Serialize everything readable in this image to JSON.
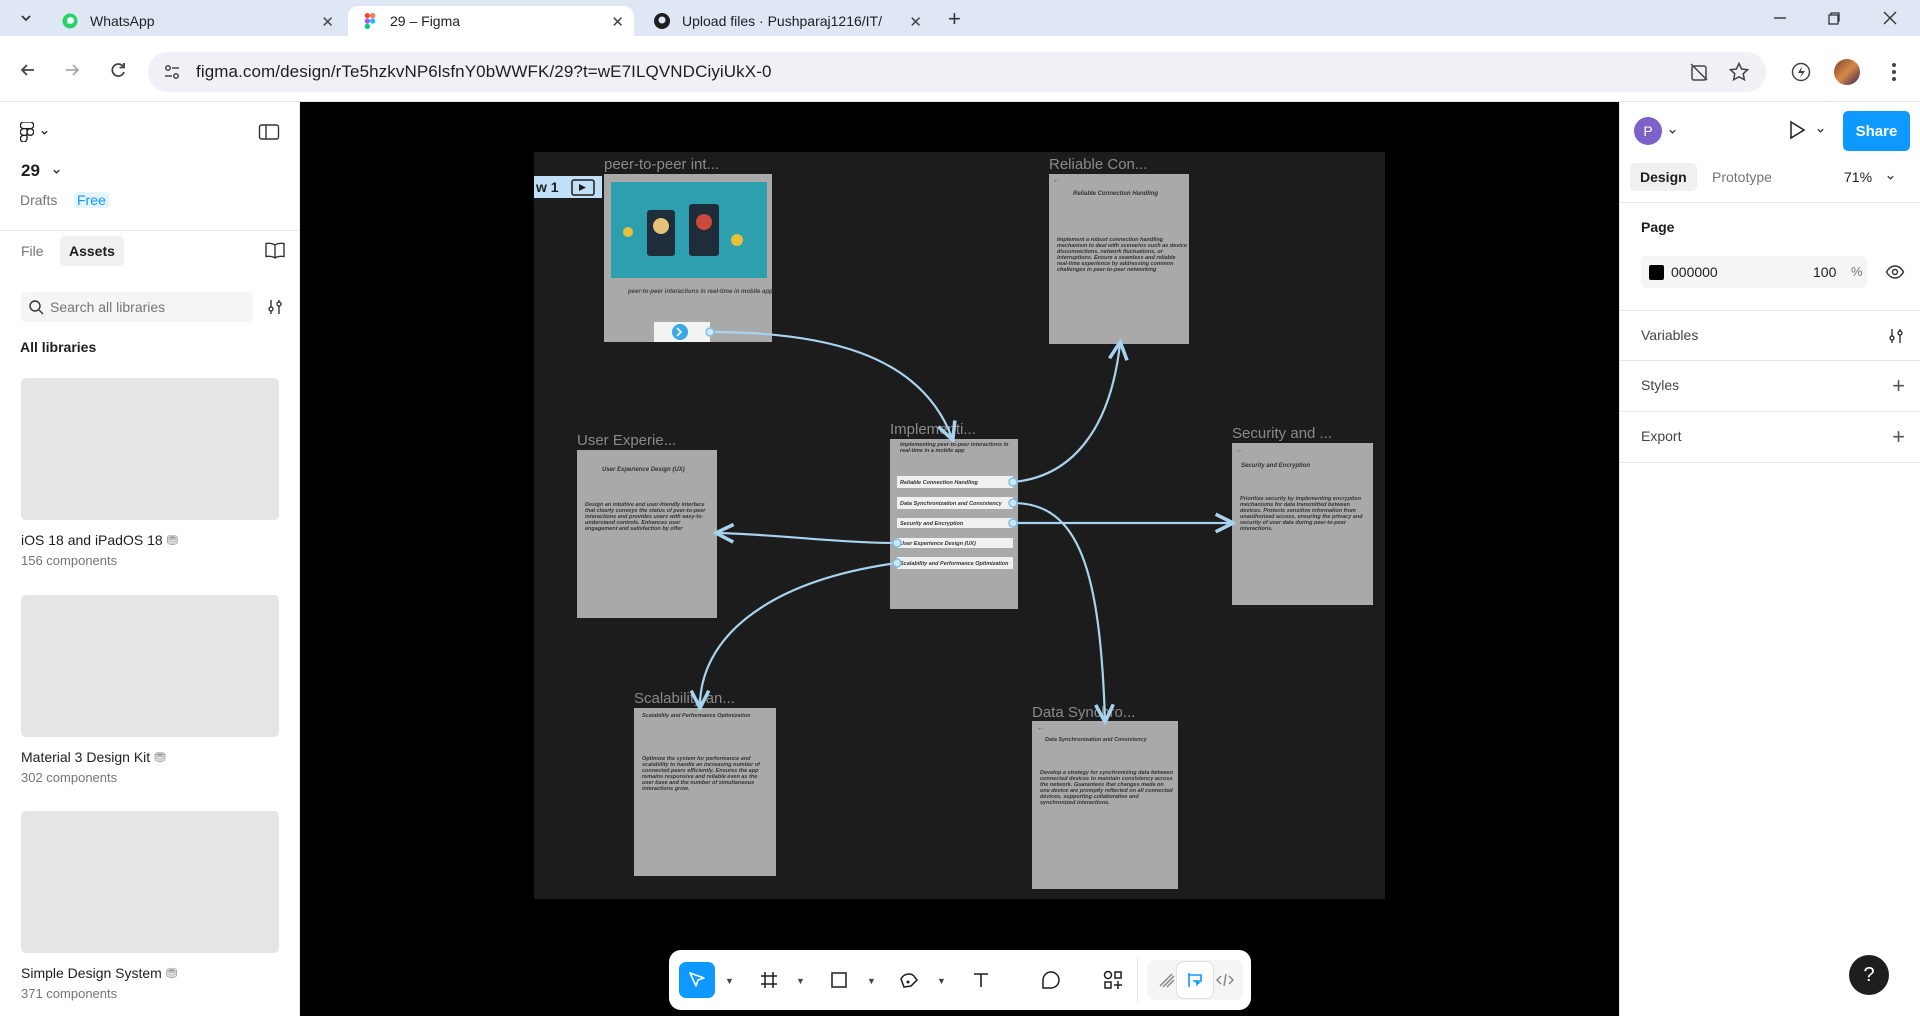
{
  "browser": {
    "tabs": [
      {
        "title": "WhatsApp",
        "icon": "whatsapp-icon"
      },
      {
        "title": "29 – Figma",
        "icon": "figma-icon",
        "active": true
      },
      {
        "title": "Upload files · Pushparaj1216/IT/",
        "icon": "github-icon"
      }
    ],
    "url": "figma.com/design/rTe5hzkvNP6lsfnY0bWWFK/29?t=wE7ILQVNDCiyiUkX-0"
  },
  "left_panel": {
    "file_name": "29",
    "drafts_label": "Drafts",
    "plan_badge": "Free",
    "tabs": [
      "File",
      "Assets"
    ],
    "search_placeholder": "Search all libraries",
    "all_libraries_label": "All libraries",
    "libraries": [
      {
        "name": "iOS 18 and iPadOS 18",
        "count": "156 components"
      },
      {
        "name": "Material 3 Design Kit",
        "count": "302 components"
      },
      {
        "name": "Simple Design System",
        "count": "371 components"
      }
    ]
  },
  "right_panel": {
    "avatar_letter": "P",
    "share_label": "Share",
    "tabs": [
      "Design",
      "Prototype"
    ],
    "zoom": "71%",
    "page_heading": "Page",
    "page_color_hex": "000000",
    "page_opacity": "100",
    "percent_sign": "%",
    "sections": [
      "Variables",
      "Styles",
      "Export"
    ]
  },
  "canvas": {
    "flow_badge": "w 1",
    "frames": [
      {
        "id": "p2p",
        "title": "peer-to-peer int...",
        "body": "peer-to-peer interactions in real-time in mobile app"
      },
      {
        "id": "reliable",
        "title": "Reliable Con...",
        "heading": "Reliable Connection Handling",
        "body": "Implement a robust connection handling mechanism to deal with scenarios such as device disconnections, network fluctuations, or interruptions. Ensure a seamless and reliable real-time experience by addressing common challenges in peer-to-peer networking"
      },
      {
        "id": "ux",
        "title": "User Experie...",
        "heading": "User Experience Design (UX)",
        "body": "Design an intuitive and user-friendly interface that clearly conveys the status of peer-to-peer interactions and provides users with easy-to-understand controls. Enhances user engagement and satisfaction by offer"
      },
      {
        "id": "impl",
        "title": "Implementi...",
        "heading": "Implementing peer-to-peer interactions in real-time in a mobile app",
        "buttons": [
          "Reliable Connection Handling",
          "Data Synchronization and Consistency",
          "Security and Encryption",
          "User Experience Design (UX)",
          "Scalability and Performance Optimization"
        ]
      },
      {
        "id": "security",
        "title": "Security and ...",
        "heading": "Security and Encryption",
        "body": "Prioritize security by implementing encryption mechanisms for data transmitted between devices. Protects sensitive information from unauthorized access, ensuring the privacy and security of user data during peer-to-peer interactions."
      },
      {
        "id": "scal",
        "title": "Scalability an...",
        "heading": "Scalability and Performance Optimization",
        "body": "Optimize the system for performance and scalability to handle an increasing number of connected peers efficiently. Ensures the app remains responsive and reliable even as the user base and the number of simultaneous interactions grow."
      },
      {
        "id": "data",
        "title": "Data Synchro...",
        "heading": "Data Synchronization and Consistency",
        "body": "Develop a strategy for synchronizing data between connected devices to maintain consistency across the network. Guarantees that changes made on one device are promptly reflected on all connected devices, supporting collaborative and synchronized interactions."
      }
    ]
  },
  "toolbar": {
    "tools": [
      "move-tool",
      "frame-tool",
      "shape-tool",
      "pen-tool",
      "text-tool",
      "comment-tool",
      "actions-tool",
      "draw-mode",
      "design-mode",
      "dev-mode"
    ]
  },
  "help_label": "?",
  "colors": {
    "accent": "#0d99ff",
    "canvas": "#000000",
    "frame": "#a9a9a9",
    "connector": "#a8d3f0"
  }
}
